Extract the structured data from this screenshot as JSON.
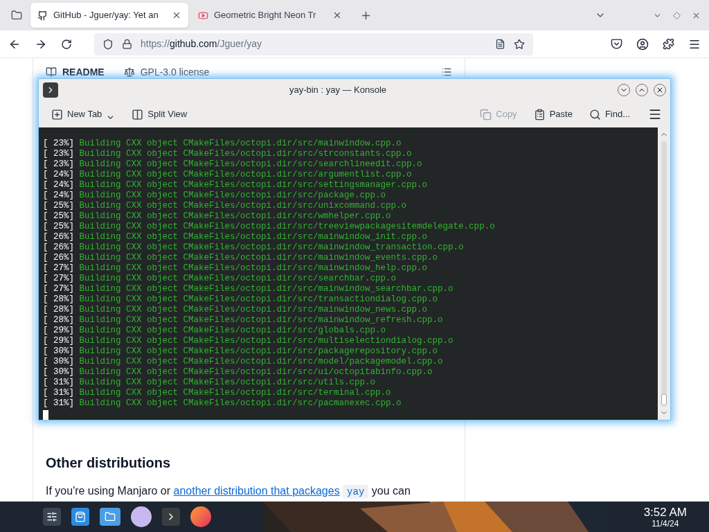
{
  "browser": {
    "tabs": [
      {
        "title": "GitHub - Jguer/yay: Yet an",
        "selected": true,
        "kind": "github"
      },
      {
        "title": "Geometric Bright Neon Tr",
        "selected": false,
        "kind": "video"
      }
    ],
    "url_prefix": "https://",
    "url_host": "github.com",
    "url_path": "/Jguer/yay"
  },
  "page": {
    "readme_tab": "README",
    "license_tab": "GPL-3.0 license",
    "heading": "Other distributions",
    "paragraph_start": "If you're using Manjaro or ",
    "link": "another distribution that packages",
    "code": "yay",
    "paragraph_end": " you can"
  },
  "konsole": {
    "title": "yay-bin : yay — Konsole",
    "toolbar": [
      {
        "label": "New Tab",
        "kind": "newtab",
        "disabled": false
      },
      {
        "label": "Split View",
        "kind": "split",
        "disabled": false
      },
      {
        "label": "Copy",
        "kind": "copy",
        "disabled": true
      },
      {
        "label": "Paste",
        "kind": "paste",
        "disabled": false
      },
      {
        "label": "Find...",
        "kind": "find",
        "disabled": false
      }
    ],
    "lines": [
      {
        "progress": "[ 23%]",
        "text": "Building CXX object CMakeFiles/octopi.dir/src/mainwindow.cpp.o"
      },
      {
        "progress": "[ 23%]",
        "text": "Building CXX object CMakeFiles/octopi.dir/src/strconstants.cpp.o"
      },
      {
        "progress": "[ 23%]",
        "text": "Building CXX object CMakeFiles/octopi.dir/src/searchlineedit.cpp.o"
      },
      {
        "progress": "[ 24%]",
        "text": "Building CXX object CMakeFiles/octopi.dir/src/argumentlist.cpp.o"
      },
      {
        "progress": "[ 24%]",
        "text": "Building CXX object CMakeFiles/octopi.dir/src/settingsmanager.cpp.o"
      },
      {
        "progress": "[ 24%]",
        "text": "Building CXX object CMakeFiles/octopi.dir/src/package.cpp.o"
      },
      {
        "progress": "[ 25%]",
        "text": "Building CXX object CMakeFiles/octopi.dir/src/unixcommand.cpp.o"
      },
      {
        "progress": "[ 25%]",
        "text": "Building CXX object CMakeFiles/octopi.dir/src/wmhelper.cpp.o"
      },
      {
        "progress": "[ 25%]",
        "text": "Building CXX object CMakeFiles/octopi.dir/src/treeviewpackagesitemdelegate.cpp.o"
      },
      {
        "progress": "[ 26%]",
        "text": "Building CXX object CMakeFiles/octopi.dir/src/mainwindow_init.cpp.o"
      },
      {
        "progress": "[ 26%]",
        "text": "Building CXX object CMakeFiles/octopi.dir/src/mainwindow_transaction.cpp.o"
      },
      {
        "progress": "[ 26%]",
        "text": "Building CXX object CMakeFiles/octopi.dir/src/mainwindow_events.cpp.o"
      },
      {
        "progress": "[ 27%]",
        "text": "Building CXX object CMakeFiles/octopi.dir/src/mainwindow_help.cpp.o"
      },
      {
        "progress": "[ 27%]",
        "text": "Building CXX object CMakeFiles/octopi.dir/src/searchbar.cpp.o"
      },
      {
        "progress": "[ 27%]",
        "text": "Building CXX object CMakeFiles/octopi.dir/src/mainwindow_searchbar.cpp.o"
      },
      {
        "progress": "[ 28%]",
        "text": "Building CXX object CMakeFiles/octopi.dir/src/transactiondialog.cpp.o"
      },
      {
        "progress": "[ 28%]",
        "text": "Building CXX object CMakeFiles/octopi.dir/src/mainwindow_news.cpp.o"
      },
      {
        "progress": "[ 28%]",
        "text": "Building CXX object CMakeFiles/octopi.dir/src/mainwindow_refresh.cpp.o"
      },
      {
        "progress": "[ 29%]",
        "text": "Building CXX object CMakeFiles/octopi.dir/src/globals.cpp.o"
      },
      {
        "progress": "[ 29%]",
        "text": "Building CXX object CMakeFiles/octopi.dir/src/multiselectiondialog.cpp.o"
      },
      {
        "progress": "[ 30%]",
        "text": "Building CXX object CMakeFiles/octopi.dir/src/packagerepository.cpp.o"
      },
      {
        "progress": "[ 30%]",
        "text": "Building CXX object CMakeFiles/octopi.dir/src/model/packagemodel.cpp.o"
      },
      {
        "progress": "[ 30%]",
        "text": "Building CXX object CMakeFiles/octopi.dir/src/ui/octopitabinfo.cpp.o"
      },
      {
        "progress": "[ 31%]",
        "text": "Building CXX object CMakeFiles/octopi.dir/src/utils.cpp.o"
      },
      {
        "progress": "[ 31%]",
        "text": "Building CXX object CMakeFiles/octopi.dir/src/terminal.cpp.o"
      },
      {
        "progress": "[ 31%]",
        "text": "Building CXX object CMakeFiles/octopi.dir/src/pacmanexec.cpp.o"
      }
    ]
  },
  "taskbar": {
    "time": "3:52 AM",
    "date": "11/4/24"
  }
}
